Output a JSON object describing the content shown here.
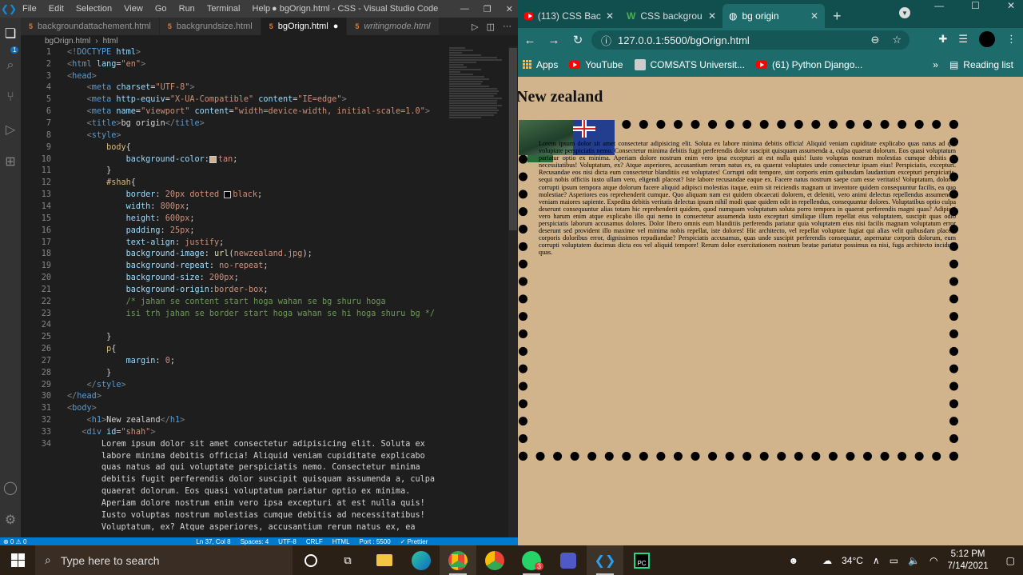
{
  "vscode": {
    "window_title": "● bgOrign.html - CSS - Visual Studio Code",
    "menu": [
      "File",
      "Edit",
      "Selection",
      "View",
      "Go",
      "Run",
      "Terminal",
      "Help"
    ],
    "tabs": [
      {
        "label": "backgroundattachement.html",
        "active": false,
        "italic": false
      },
      {
        "label": "backgrundsize.html",
        "active": false,
        "italic": false
      },
      {
        "label": "bgOrign.html",
        "active": true,
        "italic": false
      },
      {
        "label": "writingmode.html",
        "active": false,
        "italic": true
      }
    ],
    "breadcrumb": [
      "bgOrign.html",
      "html"
    ],
    "badge": "1",
    "status": {
      "errors": "⊗ 0 ⚠ 0",
      "position": "Ln 37, Col 8",
      "spaces": "Spaces: 4",
      "encoding": "UTF-8",
      "eol": "CRLF",
      "language": "HTML",
      "port": "Port : 5500",
      "prettier": "✓ Prettier"
    }
  },
  "chrome": {
    "tabs": [
      {
        "label": "(113) CSS Bac",
        "icon": "youtube-icon"
      },
      {
        "label": "CSS backgrou",
        "icon": "w3schools-icon"
      },
      {
        "label": "bg origin",
        "icon": "globe-icon",
        "active": true
      }
    ],
    "url": "127.0.0.1:5500/bgOrign.html",
    "bookmarks": [
      "Apps",
      "YouTube",
      "COMSATS Universit...",
      "(61) Python Django..."
    ],
    "reading_list": "Reading list",
    "page": {
      "heading": "New zealand",
      "body": "Lorem ipsum dolor sit amet consectetur adipisicing elit. Soluta ex labore minima debitis officia! Aliquid veniam cupiditate explicabo quas natus ad qui voluptate perspiciatis nemo. Consectetur minima debitis fugit perferendis dolor suscipit quisquam assumenda a, culpa quaerat dolorum. Eos quasi voluptatum pariatur optio ex minima. Aperiam dolore nostrum enim vero ipsa excepturi at est nulla quis! Iusto voluptas nostrum molestias cumque debitis ad necessitatibus! Voluptatum, ex? Atque asperiores, accusantium rerum natus ex, ea quaerat voluptates unde consectetur ipsam eius! Perspiciatis, excepturi. Recusandae eos nisi dicta eum consectetur blanditiis est voluptates! Corrupti odit tempore, sint corporis enim quibusdam laudantium excepturi perspiciatis, sequi nobis officiis iusto ullam vero, eligendi placeat? Iste labore recusandae eaque ex. Facere natus nostrum saepe cum esse veritatis! Voluptatum, dolores corrupti ipsum tempora atque dolorum facere aliquid adipisci molestias itaque, enim sit reiciendis magnam ut inventore quidem consequuntur facilis, ea quo molestiae? Asperiores eos reprehenderit cumque. Quo aliquam nam est quidem obcaecati dolorem, et deleniti, vero animi delectus repellendus assumenda, veniam maiores sapiente. Expedita debitis veritatis delectus ipsum nihil modi quae quidem odit in repellendus, consequuntur dolores. Voluptatibus optio culpa deserunt consequuntur alias totam hic reprehenderit quidem, quod numquam voluptatum soluta porro tempora in quaerat perferendis magni quas? Adipisci vero harum enim atque explicabo illo qui nemo in consectetur assumenda iusto excepturi similique illum repellat eius voluptatem, suscipit quas odio perspiciatis laborum accusamus dolores. Dolor libero omnis eum blanditiis perferendis pariatur quia voluptatem eius nisi facilis magnam voluptatum error deserunt sed provident illo maxime vel minima nobis repellat, iste dolores! Hic architecto, vel repellat voluptate fugiat qui alias velit quibusdam placeat corporis doloribus error, dignissimos repudiandae? Perspiciatis accusamus, quas unde suscipit perferendis consequatur, aspernatur corporis dolorum, eum corrupti voluptatem ducimus dicta eos vel aliquid tempore! Rerum dolor exercitationem nostrum beatae pariatur possimus ea nisi, fuga architecto incidunt quas."
    }
  },
  "taskbar": {
    "search_placeholder": "Type here to search",
    "weather": "34°C",
    "time": "5:12 PM",
    "date": "7/14/2021",
    "whatsapp_badge": "3"
  }
}
